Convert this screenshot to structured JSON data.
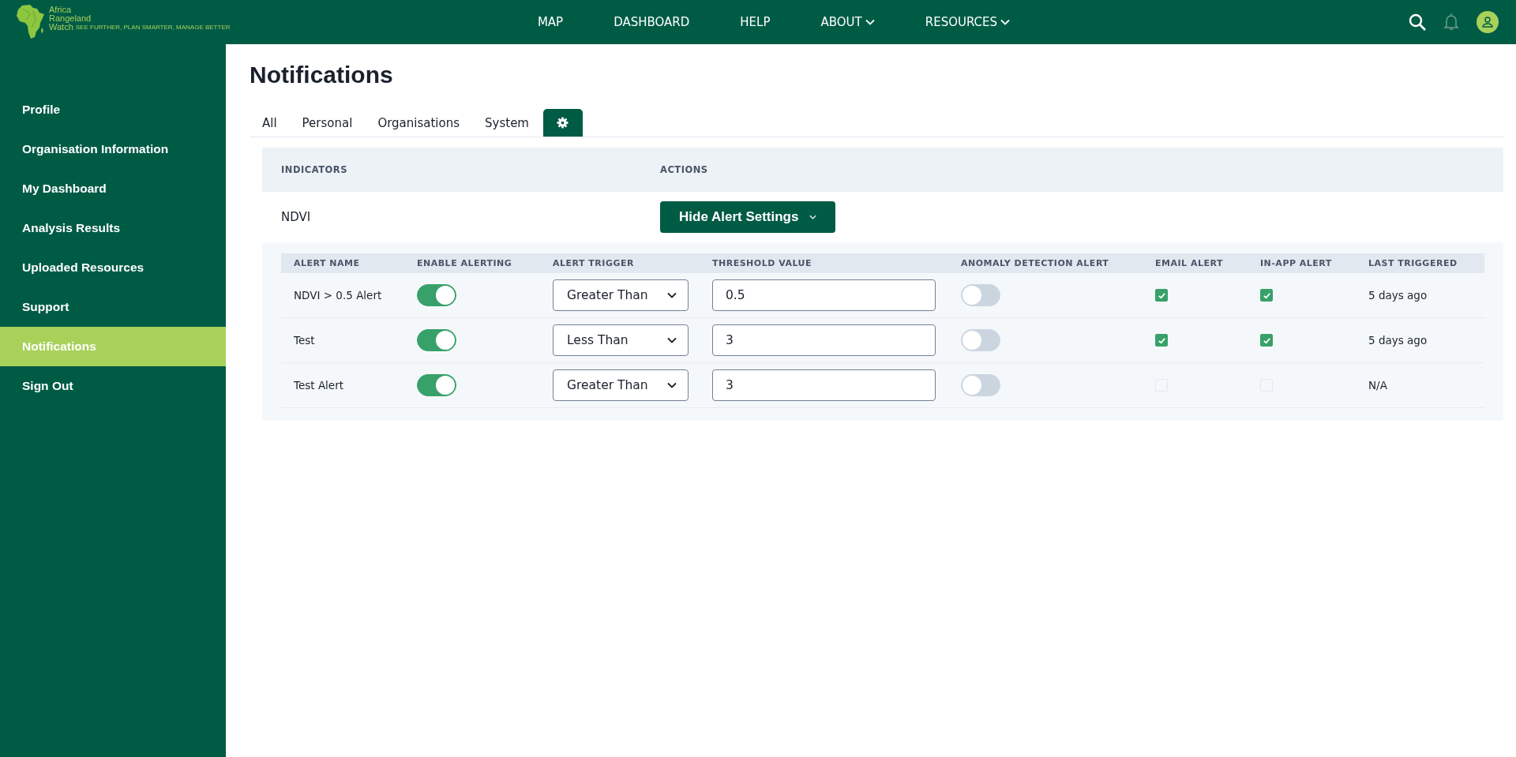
{
  "header": {
    "logo": {
      "line1": "Africa",
      "line2": "Rangeland",
      "line3": "Watch",
      "tagline": "SEE FURTHER, PLAN SMARTER, MANAGE BETTER"
    },
    "nav": [
      {
        "label": "MAP",
        "dropdown": false
      },
      {
        "label": "DASHBOARD",
        "dropdown": false
      },
      {
        "label": "HELP",
        "dropdown": false
      },
      {
        "label": "ABOUT",
        "dropdown": true
      },
      {
        "label": "RESOURCES",
        "dropdown": true
      }
    ]
  },
  "sidebar": {
    "items": [
      {
        "label": "Profile",
        "selected": false
      },
      {
        "label": "Organisation Information",
        "selected": false
      },
      {
        "label": "My Dashboard",
        "selected": false
      },
      {
        "label": "Analysis Results",
        "selected": false
      },
      {
        "label": "Uploaded Resources",
        "selected": false
      },
      {
        "label": "Support",
        "selected": false
      },
      {
        "label": "Notifications",
        "selected": true
      },
      {
        "label": "Sign Out",
        "selected": false
      }
    ]
  },
  "page_title": "Notifications",
  "tabs": [
    {
      "kind": "text",
      "label": "All",
      "selected": false
    },
    {
      "kind": "text",
      "label": "Personal",
      "selected": false
    },
    {
      "kind": "text",
      "label": "Organisations",
      "selected": false
    },
    {
      "kind": "text",
      "label": "System",
      "selected": false
    },
    {
      "kind": "settings",
      "selected": true
    }
  ],
  "indicators_table": {
    "columns": [
      "INDICATORS",
      "ACTIONS"
    ],
    "rows": [
      {
        "indicator": "NDVI",
        "action": "Hide Alert Settings"
      }
    ]
  },
  "alerts_table": {
    "columns": [
      "ALERT NAME",
      "ENABLE ALERTING",
      "ALERT TRIGGER",
      "THRESHOLD VALUE",
      "ANOMALY DETECTION ALERT",
      "EMAIL ALERT",
      "IN-APP ALERT",
      "LAST TRIGGERED"
    ],
    "rows": [
      {
        "name": "NDVI > 0.5 Alert",
        "enabled": true,
        "trigger": "Greater Than",
        "threshold": "0.5",
        "anomaly": false,
        "email": true,
        "in_app": true,
        "last_triggered": "5 days ago"
      },
      {
        "name": "Test",
        "enabled": true,
        "trigger": "Less Than",
        "threshold": "3",
        "anomaly": false,
        "email": true,
        "in_app": true,
        "last_triggered": "5 days ago"
      },
      {
        "name": "Test Alert",
        "enabled": true,
        "trigger": "Greater Than",
        "threshold": "3",
        "anomaly": false,
        "email": false,
        "in_app": false,
        "last_triggered": "N/A"
      }
    ]
  }
}
